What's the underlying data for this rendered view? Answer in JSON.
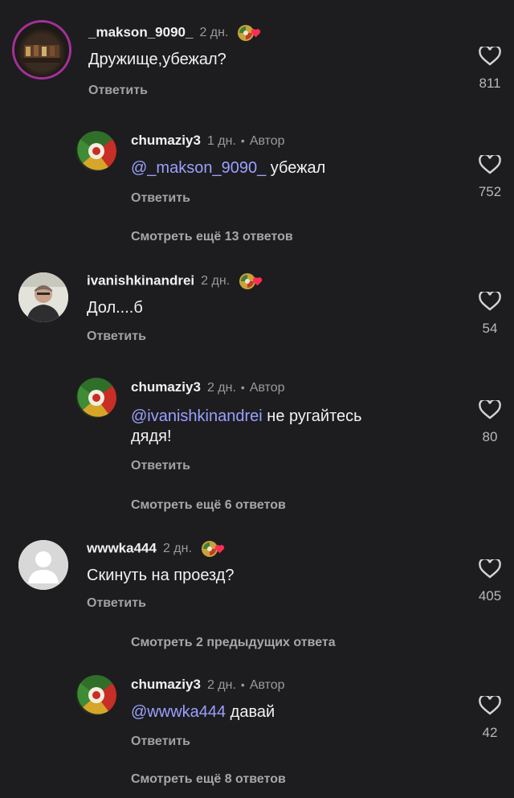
{
  "comments": [
    {
      "username": "_makson_9090_",
      "time": "2 дн.",
      "text": "Дружище,убежал?",
      "reply": "Ответить",
      "likes": "811"
    },
    {
      "username": "chumaziy3",
      "time": "1 дн.",
      "author": "Автор",
      "mention": "@_makson_9090_",
      "text": " убежал",
      "reply": "Ответить",
      "likes": "752"
    },
    {
      "username": "ivanishkinandrei",
      "time": "2 дн.",
      "text": "Дол....б",
      "reply": "Ответить",
      "likes": "54"
    },
    {
      "username": "chumaziy3",
      "time": "2 дн.",
      "author": "Автор",
      "mention": "@ivanishkinandrei",
      "text": " не ругайтесь",
      "text2": "дядя!",
      "reply": "Ответить",
      "likes": "80"
    },
    {
      "username": "wwwka444",
      "time": "2 дн.",
      "text": "Скинуть на проезд?",
      "reply": "Ответить",
      "likes": "405"
    },
    {
      "username": "chumaziy3",
      "time": "2 дн.",
      "author": "Автор",
      "mention": "@wwwka444",
      "text": " давай",
      "reply": "Ответить",
      "likes": "42"
    }
  ],
  "more_links": {
    "replies_13": "Смотреть ещё 13 ответов",
    "replies_6": "Смотреть ещё 6 ответов",
    "previous_2": "Смотреть 2 предыдущих ответа",
    "replies_8": "Смотреть ещё 8 ответов"
  },
  "icons": {
    "like": "heart-outline-icon",
    "reaction": "reaction-emoji-icon",
    "default_avatar": "person-silhouette-icon"
  },
  "colors": {
    "background": "#1d1d1f",
    "mention": "#9aa0ff",
    "muted": "#9a9a9a",
    "heart": "#ff2d55"
  }
}
